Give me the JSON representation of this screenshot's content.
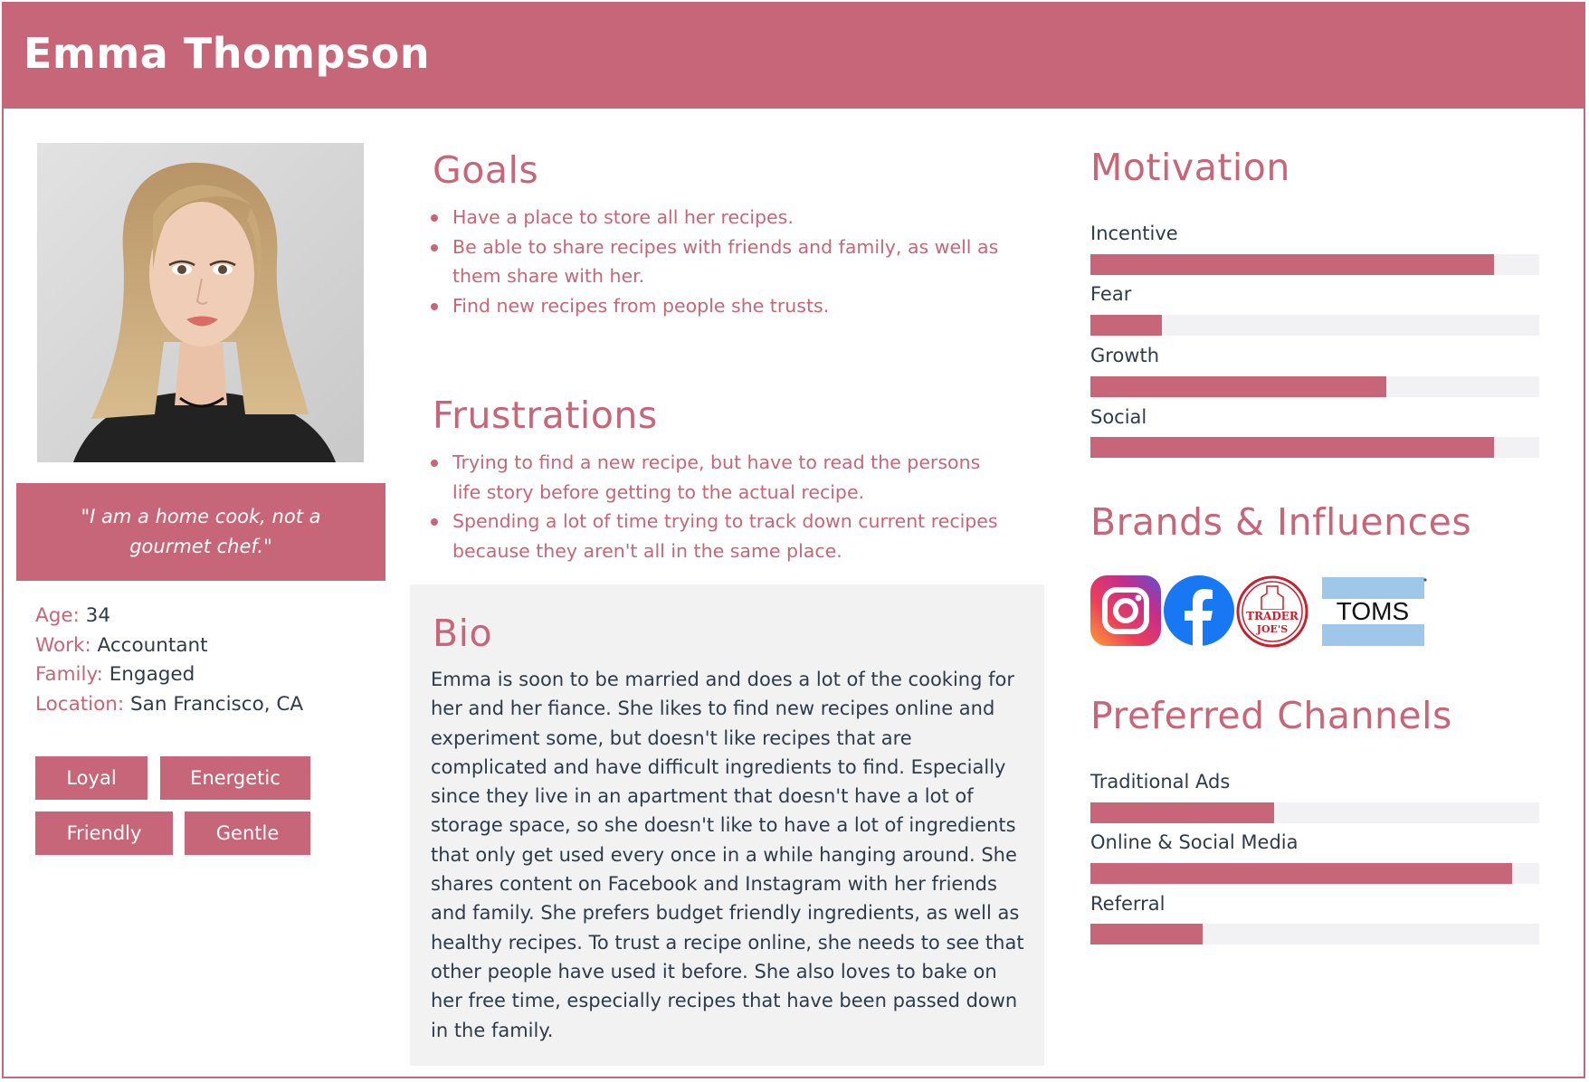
{
  "persona": {
    "name": "Emma Thompson",
    "quote": "\"I am a home cook, not a gourmet chef.\"",
    "facts": [
      {
        "key": "Age:",
        "value": "34"
      },
      {
        "key": "Work:",
        "value": "Accountant"
      },
      {
        "key": "Family:",
        "value": "Engaged"
      },
      {
        "key": "Location:",
        "value": "San Francisco,  CA"
      }
    ],
    "traits": [
      "Loyal",
      "Energetic",
      "Friendly",
      "Gentle"
    ]
  },
  "goals": {
    "title": "Goals",
    "items": [
      "Have a place to store all her recipes.",
      "Be able to share recipes with friends and family, as well as them share with her.",
      "Find new recipes from people she trusts."
    ]
  },
  "frustrations": {
    "title": "Frustrations",
    "items": [
      "Trying to find a new recipe, but have to read the persons life story before getting to the actual recipe.",
      "Spending a lot of time trying to track down current recipes because they aren't all in the same place."
    ]
  },
  "bio": {
    "title": "Bio",
    "text": "Emma is soon to be married and does a lot of the cooking for her and her fiance. She likes to find new recipes online and experiment some, but doesn't like recipes that are complicated and have difficult ingredients to find. Especially since they live in an apartment that doesn't have a lot of storage space, so she doesn't like to have a lot of ingredients that only get used every once in a while hanging around. She shares content on Facebook and Instagram with her friends and family. She prefers budget friendly ingredients, as well as healthy recipes. To trust a recipe online, she needs to see that other people have used it before. She also loves to bake on her free time, especially recipes that have been passed down in the family."
  },
  "motivation": {
    "title": "Motivation",
    "bars": [
      {
        "label": "Incentive",
        "level": 0.9
      },
      {
        "label": "Fear",
        "level": 0.16
      },
      {
        "label": "Growth",
        "level": 0.66
      },
      {
        "label": "Social",
        "level": 0.9
      }
    ]
  },
  "brands": {
    "title": "Brands & Influences",
    "logos": [
      {
        "icon": "instagram-logo"
      },
      {
        "icon": "facebook-logo"
      },
      {
        "icon": "trader-joes-logo",
        "text_line1": "TRADER",
        "text_line2": "JOE'S"
      },
      {
        "icon": "toms-logo",
        "text": "TOMS"
      }
    ]
  },
  "channels": {
    "title": "Preferred Channels",
    "bars": [
      {
        "label": "Traditional Ads",
        "level": 0.41
      },
      {
        "label": "Online & Social Media",
        "level": 0.94
      },
      {
        "label": "Referral",
        "level": 0.25
      }
    ]
  },
  "colors": {
    "accent": "#c66678",
    "text": "#2f3b48",
    "panel": "#f2f2f2",
    "track": "#f2f2f4"
  }
}
